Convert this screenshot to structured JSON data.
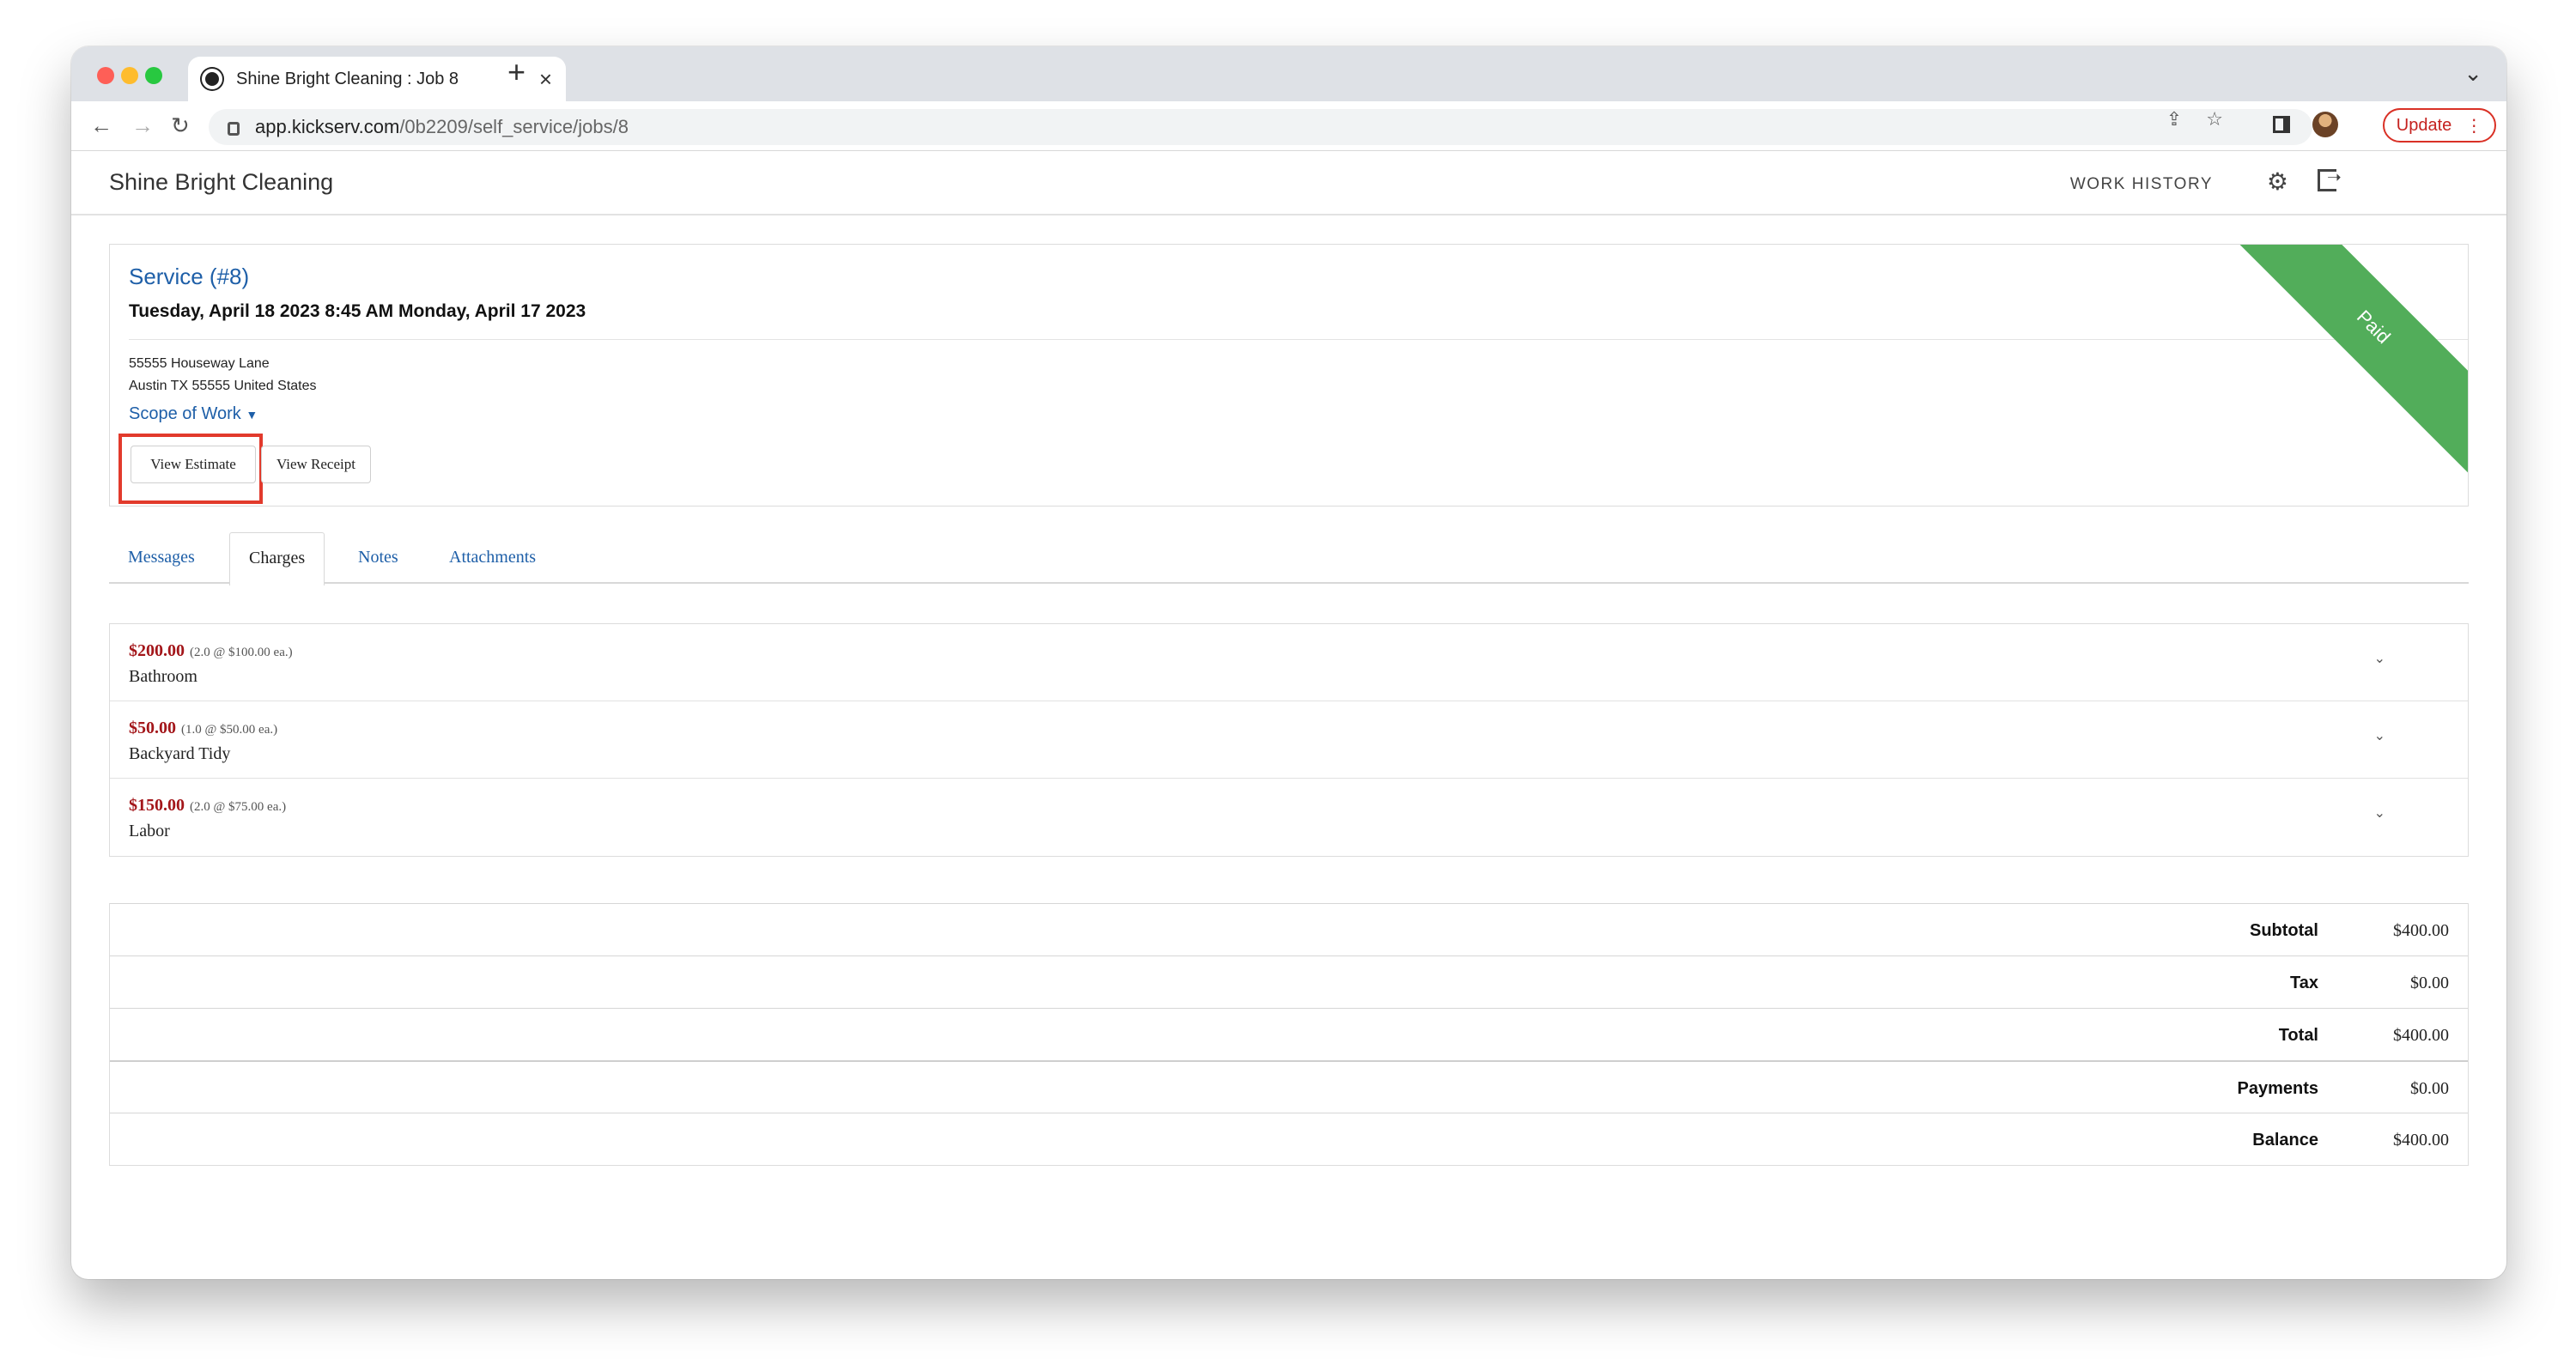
{
  "browser": {
    "tab_title": "Shine Bright Cleaning : Job 8",
    "url_host": "app.kickserv.com",
    "url_path": "/0b2209/self_service/jobs/8",
    "update_label": "Update"
  },
  "app": {
    "brand": "Shine Bright Cleaning",
    "work_history": "WORK HISTORY"
  },
  "job": {
    "title": "Service (#8)",
    "dates": "Tuesday, April 18 2023 8:45 AM Monday, April 17 2023",
    "address_line1": "55555 Houseway Lane",
    "address_line2": "Austin TX 55555 United States",
    "scope_label": "Scope of Work",
    "view_estimate": "View Estimate",
    "view_receipt": "View Receipt",
    "status": "Paid",
    "status_color": "#52ad5a"
  },
  "tabs": [
    {
      "label": "Messages"
    },
    {
      "label": "Charges"
    },
    {
      "label": "Notes"
    },
    {
      "label": "Attachments"
    }
  ],
  "charges": [
    {
      "price": "$200.00",
      "qty": "(2.0 @ $100.00 ea.)",
      "name": "Bathroom"
    },
    {
      "price": "$50.00",
      "qty": "(1.0 @ $50.00 ea.)",
      "name": "Backyard Tidy"
    },
    {
      "price": "$150.00",
      "qty": "(2.0 @ $75.00 ea.)",
      "name": "Labor"
    }
  ],
  "totals": [
    {
      "label": "Subtotal",
      "value": "$400.00"
    },
    {
      "label": "Tax",
      "value": "$0.00"
    },
    {
      "label": "Total",
      "value": "$400.00"
    },
    {
      "label": "Payments",
      "value": "$0.00"
    },
    {
      "label": "Balance",
      "value": "$400.00"
    }
  ],
  "colors": {
    "link": "#1e5fa8",
    "price": "#a3161a",
    "highlight": "#e23a2c"
  }
}
